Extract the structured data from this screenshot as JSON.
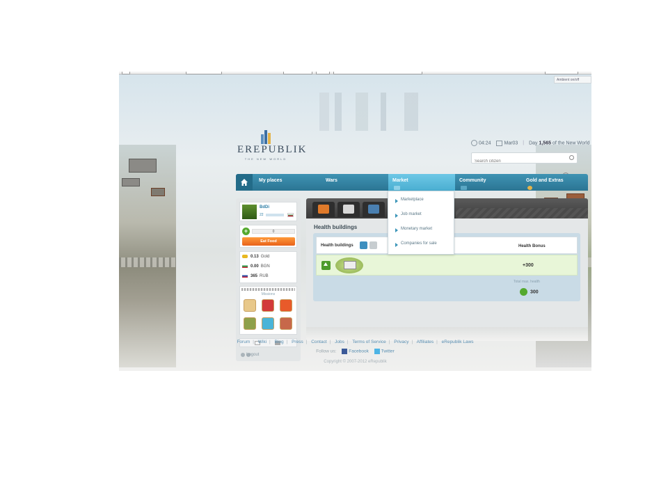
{
  "header": {
    "logo_text": "EREPUBLIK",
    "logo_tagline": "THE NEW WORLD",
    "time": "04:24",
    "date": "Mar03",
    "day_prefix": "Day",
    "day_number": "1,565",
    "day_suffix": "of the New World",
    "search_placeholder": "Search citizen",
    "ambient_toggle": "Ambient on/off"
  },
  "nav": {
    "items": [
      {
        "label": "My places"
      },
      {
        "label": "Wars"
      },
      {
        "label": "Market"
      },
      {
        "label": "Community"
      },
      {
        "label": "Gold and Extras"
      }
    ],
    "active": "Market",
    "market_dropdown": [
      "Marketplace",
      "Job market",
      "Monetary market",
      "Companies for sale"
    ]
  },
  "sidebar": {
    "citizen_name": "BdDi",
    "level": "22",
    "energy": "0",
    "eat_food": "Eat Food",
    "wallet": [
      {
        "amount": "0.13",
        "currency": "Gold",
        "color": "#e8b820"
      },
      {
        "amount": "0.00",
        "currency": "BGN",
        "color": "#2a9d4a"
      },
      {
        "amount": "365",
        "currency": "RUB",
        "color": "#d0263a"
      }
    ],
    "missions_title": "Missions",
    "logout": "Logout"
  },
  "main": {
    "section_title": "Health buildings",
    "column_buildings": "Health buildings",
    "column_bonus": "Health Bonus",
    "row_bonus": "+300",
    "total_label": "Total max. health",
    "total_value": "300"
  },
  "footer": {
    "links": [
      "Forum",
      "Wiki",
      "Blog",
      "Press",
      "Contact",
      "Jobs",
      "Terms of Service",
      "Privacy",
      "Affiliates",
      "eRepublik Laws"
    ],
    "follow_us": "Follow us:",
    "facebook": "Facebook",
    "twitter": "Twitter",
    "copyright": "Copyright © 2007-2012 eRepublik"
  },
  "colors": {
    "nav_blue": "#3f93b3",
    "nav_active": "#6ec8e6",
    "eat_food_orange": "#f07a25",
    "link_blue": "#5a8fb2",
    "health_green": "#55a92f"
  }
}
